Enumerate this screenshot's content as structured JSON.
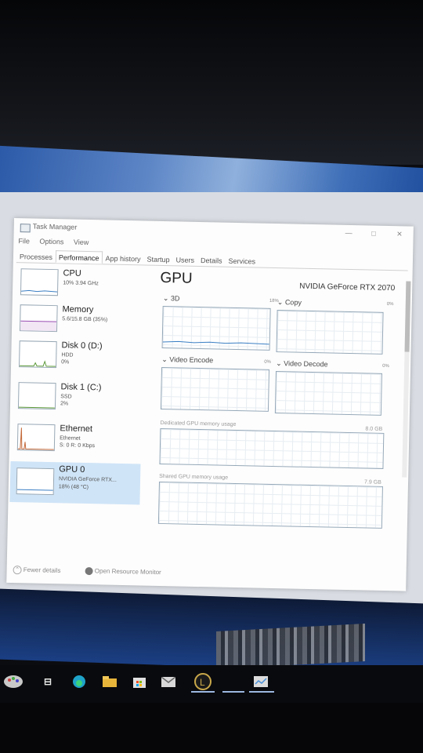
{
  "window": {
    "title": "Task Manager",
    "controls": {
      "minimize": "—",
      "maximize": "□",
      "close": "✕"
    }
  },
  "menu": {
    "items": [
      "File",
      "Options",
      "View"
    ]
  },
  "tabs": [
    {
      "label": "Processes"
    },
    {
      "label": "Performance",
      "active": true
    },
    {
      "label": "App history"
    },
    {
      "label": "Startup"
    },
    {
      "label": "Users"
    },
    {
      "label": "Details"
    },
    {
      "label": "Services"
    }
  ],
  "sidebar": {
    "items": [
      {
        "name": "CPU",
        "sub1": "10% 3.94 GHz",
        "sub2": "",
        "sub3": ""
      },
      {
        "name": "Memory",
        "sub1": "5.6/15.8 GB (35%)",
        "sub2": "",
        "sub3": ""
      },
      {
        "name": "Disk 0 (D:)",
        "sub1": "HDD",
        "sub2": "0%",
        "sub3": ""
      },
      {
        "name": "Disk 1 (C:)",
        "sub1": "SSD",
        "sub2": "2%",
        "sub3": ""
      },
      {
        "name": "Ethernet",
        "sub1": "Ethernet",
        "sub2": "S: 0 R: 0 Kbps",
        "sub3": ""
      },
      {
        "name": "GPU 0",
        "sub1": "NVIDIA GeForce RTX...",
        "sub2": "18% (48 °C)",
        "sub3": "",
        "selected": true
      }
    ]
  },
  "main": {
    "title": "GPU",
    "model": "NVIDIA GeForce RTX 2070",
    "engines": [
      {
        "label": "3D",
        "percent": "18%"
      },
      {
        "label": "Copy",
        "percent": "0%"
      },
      {
        "label": "Video Encode",
        "percent": "0%"
      },
      {
        "label": "Video Decode",
        "percent": "0%"
      }
    ],
    "dedicated_label": "Dedicated GPU memory usage",
    "dedicated_max": "8.0 GB",
    "shared_label": "Shared GPU memory usage",
    "shared_max": "7.9 GB"
  },
  "footer": {
    "fewer_details": "Fewer details",
    "open_resource_monitor": "Open Resource Monitor"
  },
  "colors": {
    "selected_bg": "#cfe4f7",
    "graph_border": "#95a8b8",
    "taskbar": "#090a0d"
  },
  "taskbar": {
    "icons": [
      "start-icon",
      "task-view-icon",
      "edge-icon",
      "file-explorer-icon",
      "store-icon",
      "mail-icon",
      "league-of-legends-icon",
      "app-icon",
      "task-manager-icon"
    ]
  }
}
